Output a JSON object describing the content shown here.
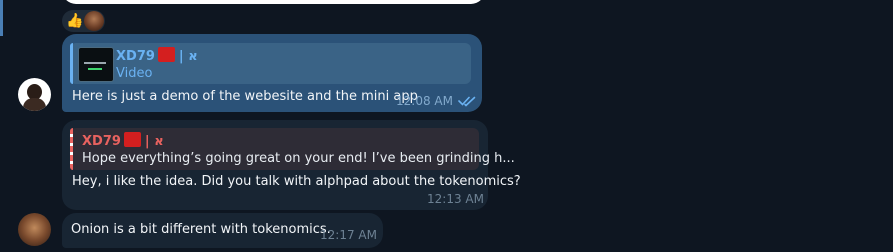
{
  "reaction": {
    "emoji": "👍"
  },
  "message_1": {
    "reply": {
      "name": "XD79",
      "suffix": "| א",
      "subtitle": "Video"
    },
    "text": "Here is just a demo of the webesite and the mini app",
    "time": "12:08 AM",
    "status_icon": "double-check-icon",
    "accent_color": "#6ab2f2"
  },
  "message_2": {
    "reply": {
      "name": "XD79",
      "suffix": "| א",
      "quote": "Hope everything’s going great on your end! I’ve been grinding h..."
    },
    "text": "Hey, i like the idea. Did you talk with alphpad about the tokenomics?",
    "time": "12:13 AM",
    "accent_color": "#e8625f"
  },
  "message_3": {
    "text": "Onion is a bit different with tokenomics.",
    "time": "12:17 AM"
  },
  "colors": {
    "background": "#0e1621",
    "outgoing_bubble": "#2b5278",
    "incoming_bubble": "#182533",
    "flag": "#d41f1f"
  }
}
